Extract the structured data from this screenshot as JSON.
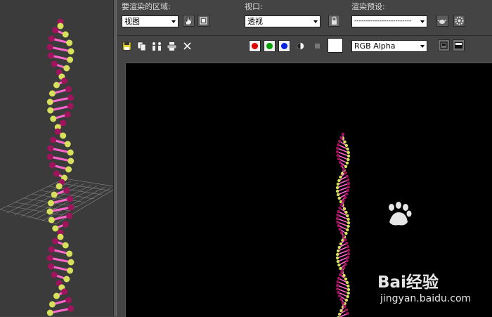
{
  "area": {
    "label": "要渲染的区域:",
    "value": "视图"
  },
  "viewport": {
    "label": "视口:",
    "value": "透视"
  },
  "preset": {
    "label": "渲染预设:",
    "value": "-------------------------"
  },
  "channel": {
    "value": "RGB Alpha"
  },
  "watermark": {
    "logo_text": "Bai经验",
    "url": "jingyan.baidu.com"
  },
  "colors": {
    "panel_bg": "#444444",
    "render_bg": "#000000",
    "strand": "#ff66cc",
    "sphere_magenta": "#a0135d",
    "sphere_yellow": "#d6e05a",
    "chip_red": "#ff0000",
    "chip_green": "#008800",
    "chip_blue": "#0000dd"
  },
  "icons": [
    "hand-icon",
    "copy-region-icon",
    "lock-icon",
    "teapot-preset-icon",
    "gear-icon",
    "save-icon",
    "copy-icon",
    "clone-icon",
    "print-icon",
    "clear-icon",
    "mono-icon",
    "swatch-icon",
    "display-toggle-icon",
    "display-frame-icon"
  ]
}
